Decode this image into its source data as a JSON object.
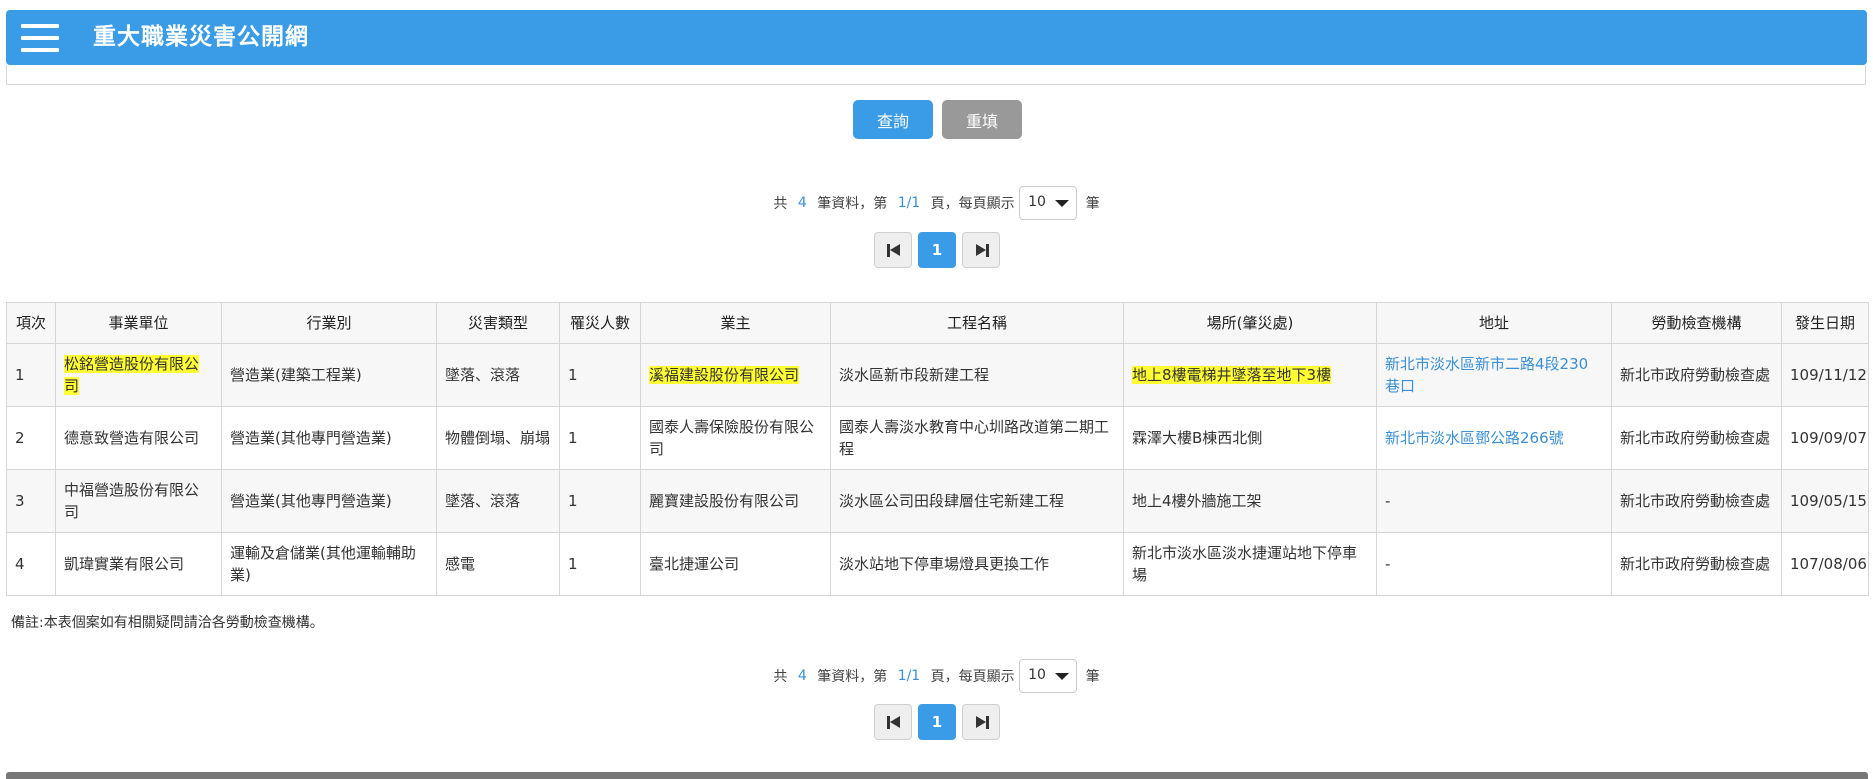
{
  "header": {
    "menu_icon": "hamburger-menu-icon",
    "title": "重大職業災害公開網",
    "color": "#3a9be6"
  },
  "search_buttons": {
    "query_label": "查詢",
    "reset_label": "重填"
  },
  "pager": {
    "prefix": "共",
    "total": "4",
    "mid1": "筆資料，第",
    "page": "1/1",
    "mid2": "頁，每頁顯示",
    "page_size": "10",
    "suffix": "筆",
    "current_page": "1",
    "first_icon": "first-page-icon",
    "next_icon": "next-page-icon"
  },
  "table": {
    "headers": [
      "項次",
      "事業單位",
      "行業別",
      "災害類型",
      "罹災人數",
      "業主",
      "工程名稱",
      "場所(肇災處)",
      "地址",
      "勞動檢查機構",
      "發生日期"
    ],
    "rows": [
      [
        "1",
        "松銘營造股份有限公司",
        "營造業(建築工程業)",
        "墜落、滾落",
        "1",
        "溪福建設股份有限公司",
        "淡水區新市段新建工程",
        "地上8樓電梯井墜落至地下3樓",
        "新北市淡水區新市二路4段230巷口",
        "新北市政府勞動檢查處",
        "109/11/12"
      ],
      [
        "2",
        "德意致營造有限公司",
        "營造業(其他專門營造業)",
        "物體倒塌、崩塌",
        "1",
        "國泰人壽保險股份有限公司",
        "國泰人壽淡水教育中心圳路改道第二期工程",
        "霖澤大樓B棟西北側",
        "新北市淡水區鄧公路266號",
        "新北市政府勞動檢查處",
        "109/09/07"
      ],
      [
        "3",
        "中福營造股份有限公司",
        "營造業(其他專門營造業)",
        "墜落、滾落",
        "1",
        "麗寶建設股份有限公司",
        "淡水區公司田段肆層住宅新建工程",
        "地上4樓外牆施工架",
        "-",
        "新北市政府勞動檢查處",
        "109/05/15"
      ],
      [
        "4",
        "凱瑋實業有限公司",
        "運輸及倉儲業(其他運輸輔助業)",
        "感電",
        "1",
        "臺北捷運公司",
        "淡水站地下停車場燈具更換工作",
        "新北市淡水區淡水捷運站地下停車場",
        "-",
        "新北市政府勞動檢查處",
        "107/08/06"
      ]
    ],
    "highlight_color": "#ffff33",
    "link_color": "#3a8fd8"
  },
  "note": "備註:本表個案如有相關疑問請洽各勞動檢查機構。"
}
